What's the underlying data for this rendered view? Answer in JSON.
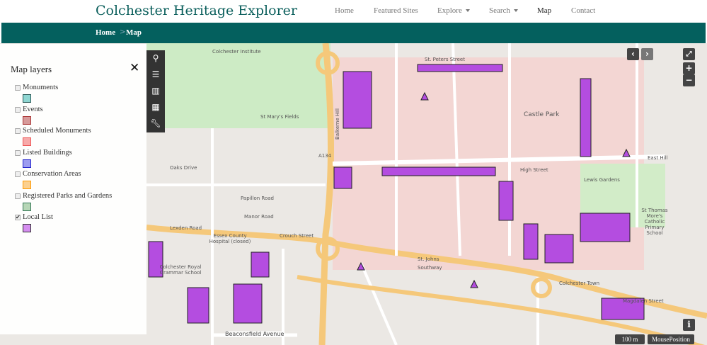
{
  "header": {
    "title": "Colchester Heritage Explorer",
    "nav": [
      {
        "label": "Home"
      },
      {
        "label": "Featured Sites"
      },
      {
        "label": "Explore"
      },
      {
        "label": "Search"
      },
      {
        "label": "Map"
      },
      {
        "label": "Contact"
      }
    ]
  },
  "breadcrumb": {
    "items": [
      "Home",
      "Map"
    ],
    "separator": ">"
  },
  "panel": {
    "title": "Map layers",
    "layers": [
      {
        "label": "Monuments",
        "checked": false,
        "fill": "#8fd6d2",
        "stroke": "#2a5856"
      },
      {
        "label": "Events",
        "checked": false,
        "fill": "#d79a9a",
        "stroke": "#a33"
      },
      {
        "label": "Scheduled Monuments",
        "checked": false,
        "fill": "#f7a9a9",
        "stroke": "#e55"
      },
      {
        "label": "Listed Buildings",
        "checked": false,
        "fill": "#9c9cf0",
        "stroke": "#22c"
      },
      {
        "label": "Conservation Areas",
        "checked": false,
        "fill": "#fbd08f",
        "stroke": "#f90"
      },
      {
        "label": "Registered Parks and Gardens",
        "checked": false,
        "fill": "#b6d6b6",
        "stroke": "#375"
      },
      {
        "label": "Local List",
        "checked": true,
        "fill": "#d58ef0",
        "stroke": "#333"
      }
    ]
  },
  "map": {
    "scale": "100 m",
    "mouse_position": "MousePosition",
    "labels": [
      "Colchester Institute",
      "St. Peters Street",
      "Castle Park",
      "Balkerne Hill",
      "A134",
      "High Street",
      "Lewis Gardens",
      "Southway",
      "St. Johns",
      "Colchester Town",
      "Magdalen Street",
      "Lexden Road",
      "Oaks Drive",
      "Papillon Road",
      "Manor Road",
      "Essex County Hospital (closed)",
      "Colchester Royal Grammar School",
      "Beaconsfield Avenue",
      "St Mary's Fields",
      "Crouch Street",
      "East Hill",
      "St Thomas More's Catholic Primary School"
    ]
  },
  "colors": {
    "teal": "#04605e",
    "local_list": "#b44de0"
  }
}
